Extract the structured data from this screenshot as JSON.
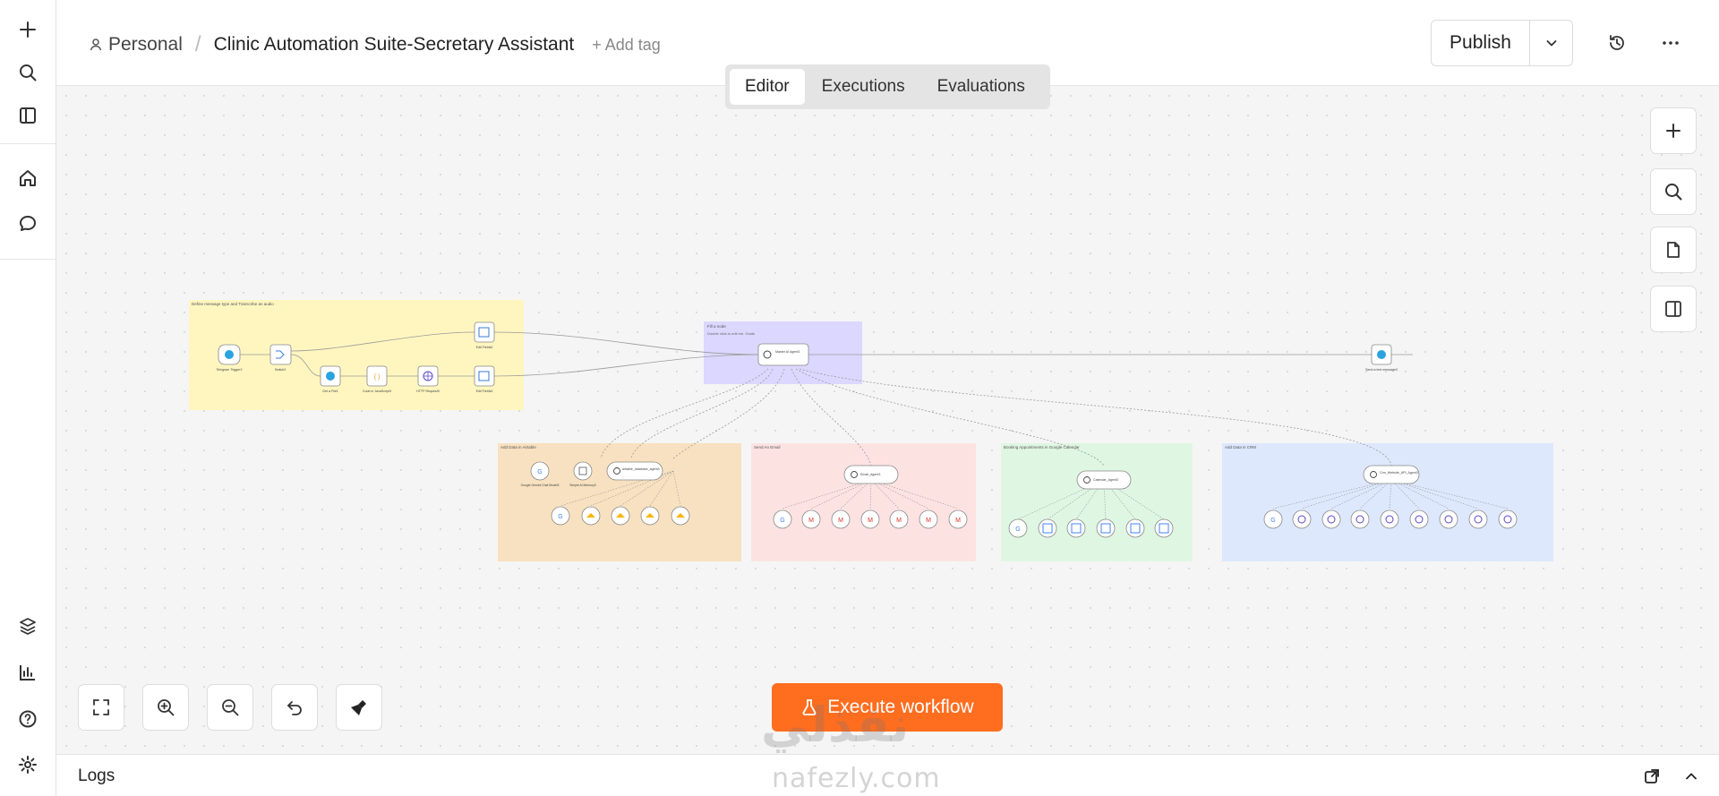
{
  "header": {
    "project": "Personal",
    "workflow_title": "Clinic Automation Suite-Secretary Assistant",
    "add_tag": "+ Add tag",
    "publish_label": "Publish"
  },
  "tabs": [
    {
      "label": "Editor",
      "active": true
    },
    {
      "label": "Executions",
      "active": false
    },
    {
      "label": "Evaluations",
      "active": false
    }
  ],
  "sidebar": {
    "top_icons": [
      "plus-icon",
      "search-icon",
      "panel-icon",
      "home-icon",
      "chat-icon"
    ],
    "bottom_icons": [
      "templates-icon",
      "insights-icon",
      "help-icon",
      "settings-icon"
    ]
  },
  "canvas": {
    "groups": [
      {
        "title": "Define message type and Transcribe an audio",
        "color": "#fff6bf"
      },
      {
        "title": "Fill a node",
        "color": "#dcd7ff"
      },
      {
        "title": "Add Data in Airtable",
        "color": "#f8e1c0"
      },
      {
        "title": "Send An Email",
        "color": "#fde2e2"
      },
      {
        "title": "Booking Appointments in Google Calendar",
        "color": "#dff6e3"
      },
      {
        "title": "Add Data in CRM",
        "color": "#dde8fd"
      }
    ],
    "fill_note": "Double click to edit me. Guide",
    "nodes": {
      "telegram_trigger": "Telegram Trigger2",
      "switch": "Switch3",
      "get_file": "Get a File1",
      "code": "Code in JavaScript3",
      "http": "HTTP Request3",
      "edit_fields1": "Edit Fields2",
      "edit_fields2": "Edit Fields3",
      "master_agent": "Master AI Agent3",
      "send_message": "Send a text message3",
      "gemini1": "Google Gemini Chat Model3",
      "memory": "Simple AI Memory3",
      "airtable_agent": "airtable_database_agent3",
      "email_agent": "Email_Agent3",
      "calendar_agent": "Calendar_Agent3",
      "crm_agent": "Crm_Website_API_Agent3"
    }
  },
  "controls": {
    "execute_label": "Execute workflow",
    "logs_label": "Logs"
  },
  "watermark": {
    "arabic": "نفذلي",
    "latin": "nafezly.com"
  },
  "colors": {
    "accent": "#ff6d1f"
  }
}
